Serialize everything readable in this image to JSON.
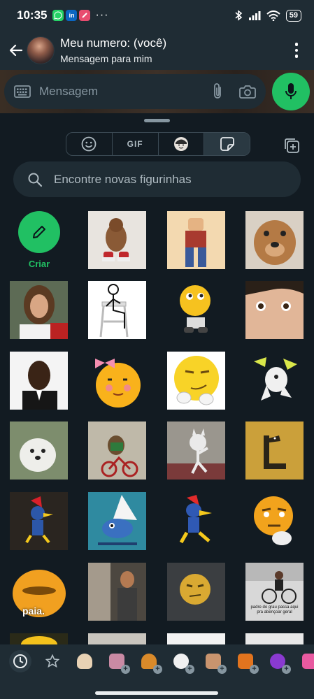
{
  "status_bar": {
    "time": "10:35",
    "apps": [
      "whatsapp-icon",
      "linkedin-icon",
      "app-icon"
    ],
    "more": "···",
    "battery": "59"
  },
  "header": {
    "title": "Meu numero: (você)",
    "subtitle": "Mensagem para mim"
  },
  "composer": {
    "placeholder": "Mensagem"
  },
  "panel": {
    "tabs": [
      {
        "name": "emoji-tab",
        "label": "",
        "icon": "smiley-icon"
      },
      {
        "name": "gif-tab",
        "label": "GIF",
        "icon": ""
      },
      {
        "name": "avatar-tab",
        "label": "",
        "icon": "avatar-icon"
      },
      {
        "name": "sticker-tab",
        "label": "",
        "icon": "sticker-icon",
        "active": true
      }
    ],
    "search_placeholder": "Encontre novas figurinhas",
    "create_label": "Criar",
    "sticker_captions": {
      "paia": "paia.",
      "padre": "padre do grau passa aqui pra abençoar geral"
    }
  },
  "colors": {
    "accent": "#21c063",
    "background": "#121b22",
    "bar": "#1f2c34"
  }
}
